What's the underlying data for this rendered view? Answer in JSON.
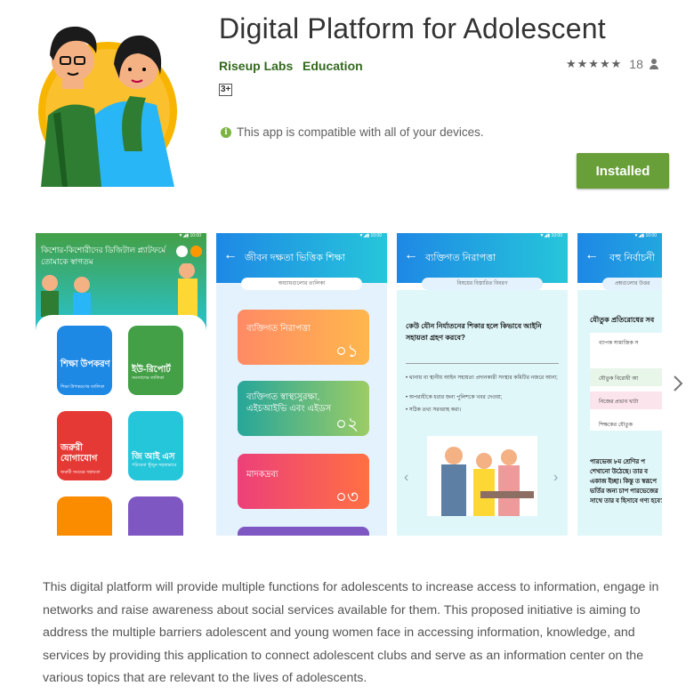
{
  "app": {
    "title": "Digital Platform for Adolescent",
    "developer": "Riseup Labs",
    "category": "Education",
    "stars": "★★★★★",
    "rating_count": "18",
    "age_rating": "3+",
    "compat_text": "This app is compatible with all of your devices.",
    "install_label": "Installed"
  },
  "colors": {
    "accent_green": "#689f38",
    "link_green": "#33691e",
    "blue_header": "#1e88e5"
  },
  "screens": [
    {
      "header": "কিশোর-কিশোরীদের ডিজিটাল প্ল্যাটফর্মে তোমাকে স্বাগতম",
      "tiles": [
        {
          "title": "শিক্ষা উপকরণ",
          "sub": "শিক্ষা উপকরণের তালিকা"
        },
        {
          "title": "ইউ-রিপোর্ট",
          "sub": "সমস্যাদের তালিকা"
        },
        {
          "title": "জরুরী যোগাযোগ",
          "sub": "জরুরী সময়ের সহায়তা"
        },
        {
          "title": "জি আই এস",
          "sub": "পরিষেবা খুঁজুন সহজভাবে"
        }
      ]
    },
    {
      "header": "জীবন দক্ষতা ভিত্তিক শিক্ষা",
      "subtitle": "অধ্যায়গুলোর তালিকা",
      "cards": [
        {
          "label": "ব্যক্তিগত নিরাপত্তা",
          "num": "০১"
        },
        {
          "label": "ব্যক্তিগত স্বাস্থ্যসুরক্ষা, এইচআইভি এবং এইডস",
          "num": "০২"
        },
        {
          "label": "মাদকদ্রব্য",
          "num": "০৩"
        }
      ]
    },
    {
      "header": "ব্যক্তিগত নিরাপত্তা",
      "subtitle": "বিষয়ের বিস্তারিত বিবরণ",
      "question": "কেউ যৌন নির্যাতনের শিকার হলে কিভাবে আইনি সহায়তা গ্রহণ করবে?",
      "bullets": [
        "• থানায় বা স্থানীয় আইন সহায়তা প্রদানকারী সংস্থার কমিটির নজরে আনা;",
        "• অপরাধীকে ধরার জন্য পুলিশকে খবর দেওয়া;",
        "• সঠিক তথ্য সরবরাহ করা।"
      ]
    },
    {
      "header": "বহু নির্বাচনী",
      "subtitle": "প্রশ্নগুলোর উত্তর",
      "question": "যৌতুক প্রতিরোধের সব",
      "options": [
        "ব্যাপক সামাজিক স",
        "যৌতুক বিরোধী আ",
        "নিজের প্রভাব খাটা",
        "শিক্ষকের যৌতুক"
      ],
      "footer": "পারভেজ ৮ম শ্রেণির প শেখানো উঠেছে। তার ব একাজ ইচ্ছা। কিন্তু ত স্বরূপে ভর্তির জন্য চাপ পারভেজের সাথে তার ব হিসাবে গণ্য হবে?"
    }
  ],
  "description": "This digital platform will provide multiple functions for adolescents to increase access to information, engage in networks and raise awareness about social services available for them. This proposed initiative is aiming to address the multiple barriers adolescent and young women face in accessing information, knowledge, and services by providing this application to connect adolescent clubs and serve as an information center on the various topics that are relevant to the lives of adolescents."
}
